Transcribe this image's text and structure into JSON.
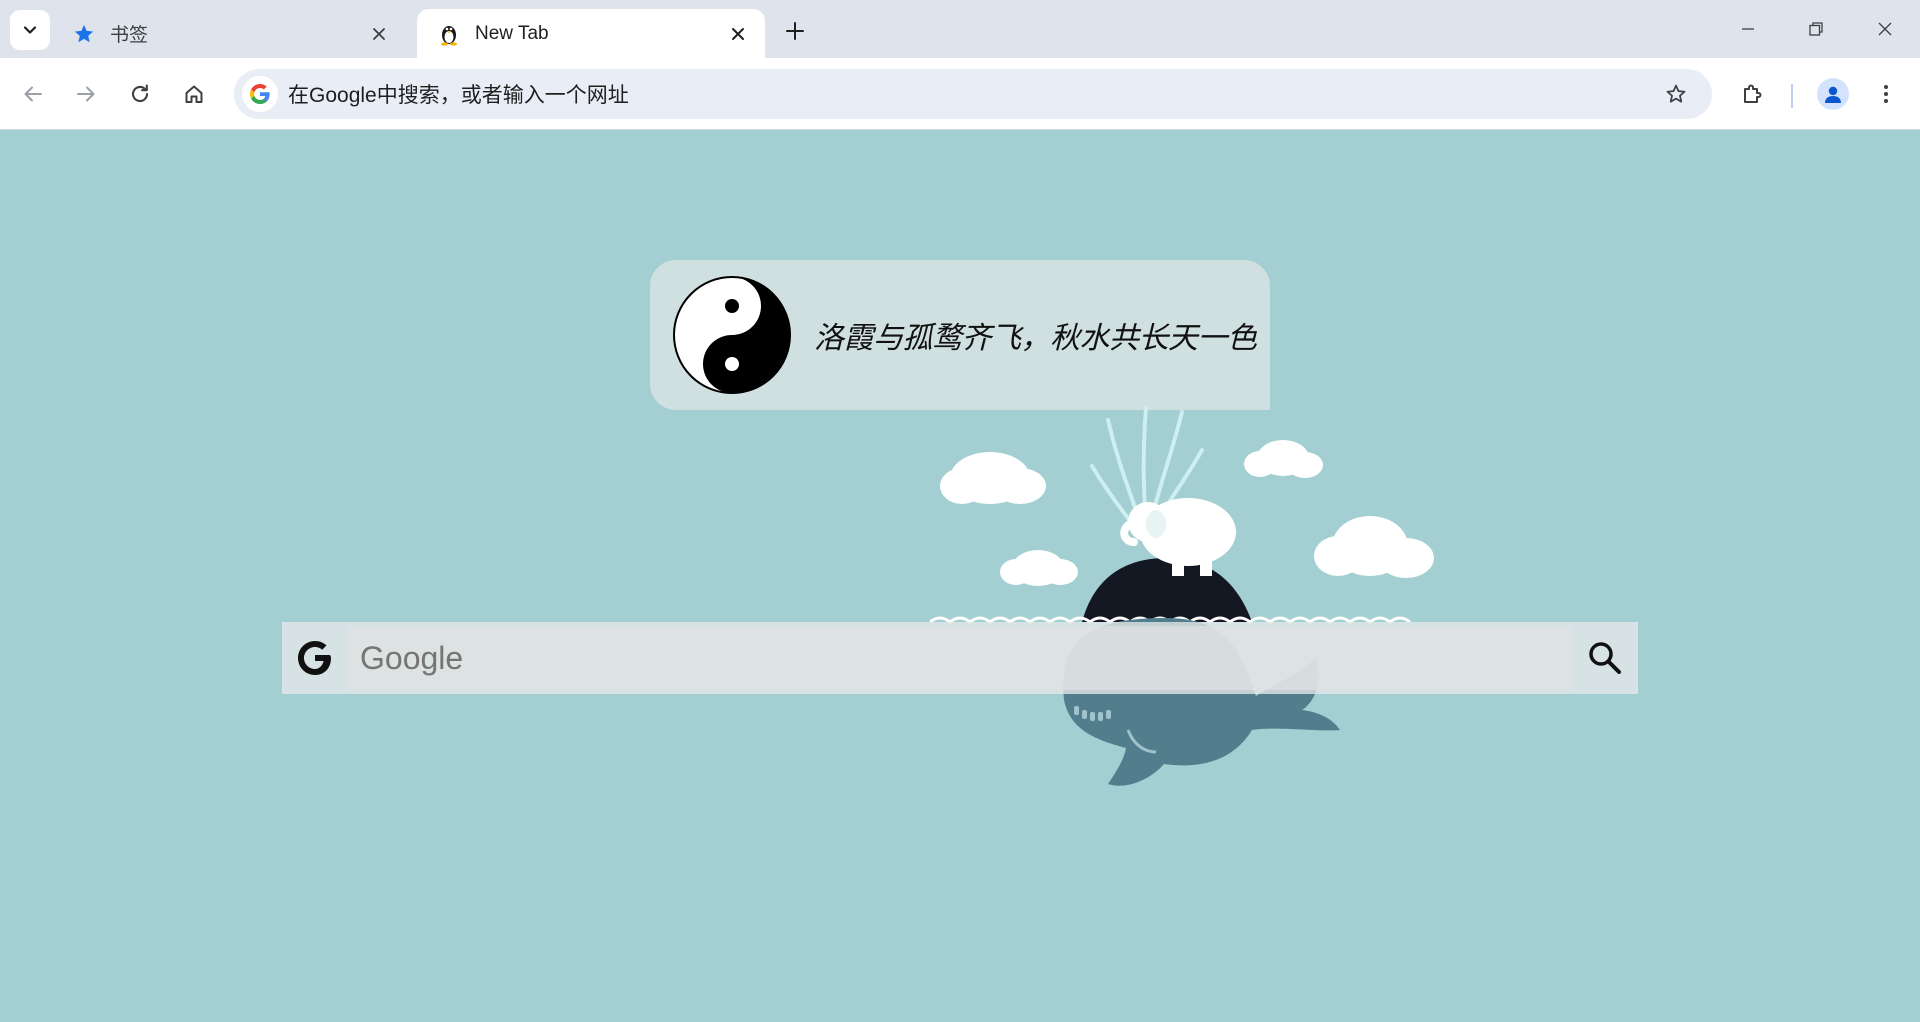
{
  "browser": {
    "tabs": [
      {
        "title": "书签",
        "favicon": "star-icon",
        "active": false
      },
      {
        "title": "New Tab",
        "favicon": "penguin-icon",
        "active": true
      }
    ],
    "omnibox_placeholder": "在Google中搜索，或者输入一个网址"
  },
  "page": {
    "quote": "洛霞与孤鹜齐飞，秋水共长天一色",
    "search_placeholder": "Google"
  },
  "colors": {
    "page_background": "#a3ced2",
    "tabstrip": "#dfe3ec",
    "omnibox": "#e9edf6",
    "accent_blue": "#1a73e8",
    "whale_body": "#527d8c",
    "whale_top": "#141822"
  }
}
